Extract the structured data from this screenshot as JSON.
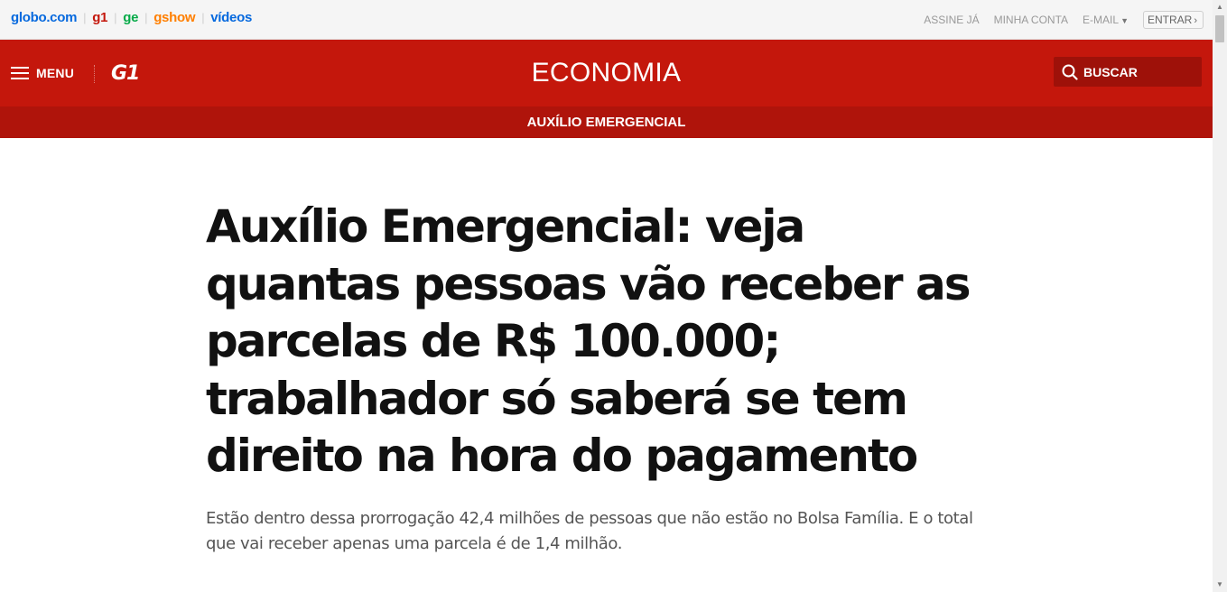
{
  "topbar": {
    "brands": [
      "globo.com",
      "g1",
      "ge",
      "gshow",
      "vídeos"
    ],
    "links": {
      "assine": "ASSINE JÁ",
      "minha_conta": "MINHA CONTA",
      "email": "E-MAIL",
      "entrar": "ENTRAR"
    }
  },
  "header": {
    "menu_label": "MENU",
    "logo": "G1",
    "section": "ECONOMIA",
    "search_label": "BUSCAR"
  },
  "subheader": {
    "topic": "AUXÍLIO EMERGENCIAL"
  },
  "article": {
    "headline": "Auxílio Emergencial: veja quantas pessoas vão receber as parcelas de R$ 100.000; trabalhador só saberá se tem direito na hora do pagamento",
    "subtitle": "Estão dentro dessa prorrogação 42,4 milhões de pessoas que não estão no Bolsa Família. E o total que vai receber apenas uma parcela é de 1,4 milhão."
  },
  "colors": {
    "brand_red": "#c4170c",
    "subheader_red": "#af140b",
    "search_bg": "#9e1109",
    "globo_blue": "#0669de",
    "ge_green": "#06aa48",
    "gshow_orange": "#ff7f00"
  },
  "icons": {
    "menu": "hamburger-icon",
    "search": "search-icon",
    "email_dropdown": "chevron-down-icon",
    "entrar": "chevron-right-icon"
  }
}
